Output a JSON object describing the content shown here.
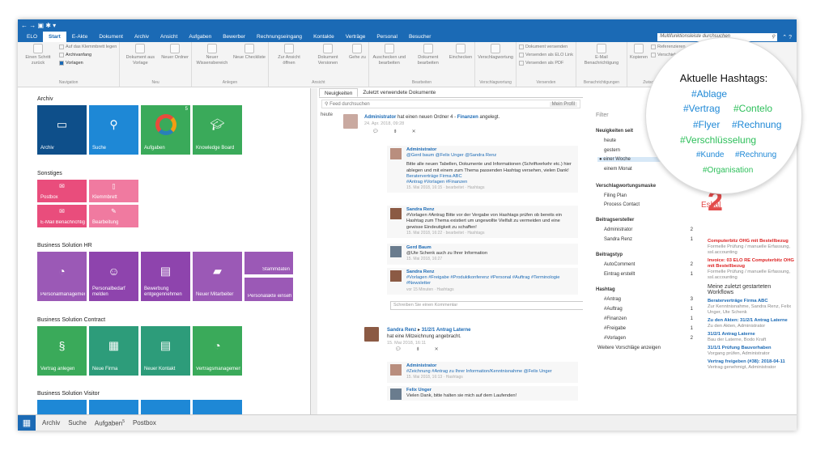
{
  "title": {
    "icons": "← → ▣ ✱ ▾"
  },
  "menu": {
    "items": [
      "ELO",
      "Start",
      "E-Akte",
      "Dokument",
      "Archiv",
      "Ansicht",
      "Aufgaben",
      "Bewerber",
      "Rechnungseingang",
      "Kontakte",
      "Verträge",
      "Personal",
      "Besucher"
    ],
    "active": "Start",
    "search_placeholder": "Multifunktionsleiste durchsuchen",
    "search_icon": "magnifier-icon",
    "help": "⌃ ?"
  },
  "ribbon": {
    "nav": {
      "b1": "Einen Schritt zurück",
      "s1": "Auf das Klemmbrett legen",
      "s2": "Archivanfang",
      "s3": "Vorlagen",
      "label": "Navigation"
    },
    "neu": {
      "b1": "Dokument aus Vorlage",
      "b2": "Neuer Ordner",
      "label": "Neu"
    },
    "anlegen": {
      "b1": "Neuer Wissensbereich",
      "b2": "Neue Checkliste",
      "label": "Anlegen"
    },
    "ansicht": {
      "b1": "Zur Ansicht öffnen",
      "b2": "Dokument Versionen",
      "b3": "Gehe zu",
      "label": "Ansicht"
    },
    "bearbeiten": {
      "b1": "Auschecken und bearbeiten",
      "b2": "Dokument bearbeiten",
      "b3": "Einchecken",
      "label": "Bearbeiten"
    },
    "vers": {
      "b1": "Verschlagwortung",
      "label": "Verschlagwortung"
    },
    "versenden": {
      "s1": "Dokument versenden",
      "s2": "Versenden als ELO Link",
      "s3": "Versenden als PDF",
      "label": "Versenden"
    },
    "benach": {
      "b1": "E-Mail Benachrichtigung",
      "label": "Benachrichtigungen"
    },
    "zw": {
      "b1": "Kopieren",
      "s1": "Referenzieren",
      "s2": "Verschieben",
      "label": "Zwischenablage"
    }
  },
  "left": {
    "archiv": {
      "title": "Archiv",
      "tiles": [
        "Archiv",
        "Suche",
        "Aufgaben",
        "Knowledge Board"
      ],
      "badge": "5"
    },
    "sonstiges": {
      "title": "Sonstiges",
      "tiles": [
        "Postbox",
        "Klemmbrett",
        "E-Mail Benachrichtigung",
        "Bearbeitung"
      ]
    },
    "hr": {
      "title": "Business Solution HR",
      "tiles": [
        "Personalmanagement",
        "Personalbedarf melden",
        "Bewerbung entgegennehmen",
        "Neuer Mitarbeiter",
        "Stammdaten ändern",
        "Personalakte einsehen"
      ]
    },
    "contract": {
      "title": "Business Solution Contract",
      "tiles": [
        "Vertrag anlegen",
        "Neue Firma",
        "Neuer Kontakt",
        "Vertragsmanagement"
      ]
    },
    "visitor": {
      "title": "Business Solution Visitor"
    }
  },
  "center": {
    "tabs": [
      "Neuigkeiten",
      "Zuletzt verwendete Dokumente"
    ],
    "feed_placeholder": "Feed durchsuchen",
    "mein_profil": "Mein Profil",
    "heute": "heute",
    "post1": {
      "author": "Administrator",
      "text": "hat einen neuen Ordner 4 -",
      "folder": "Finanzen",
      "suffix": "angelegt.",
      "date": "24. Apr. 2018, 09:28"
    },
    "c1": {
      "author": "Administrator",
      "mentions": "@Gerd baum @Felix Unger @Sandra Renz",
      "body": "Bitte alle neuen Tabellen, Dokumente und Informationen (Schriftverkehr etc.) hier ablegen und mit einem zum Thema passenden Hashtag versehen, vielen Dank!",
      "link": "Beraterverträge Firma ABC",
      "tags": "#Antrag #Vorlagen #Finanzen",
      "meta": "15. Mai 2018, 16:15 · bearbeitet · Hashtags"
    },
    "c2": {
      "author": "Sandra Renz",
      "body": "#Vorlagen #Antrag Bitte vor der Vergabe von Hashtags prüfen ob bereits ein Hashtag zum Thema existiert um ungewollte Vielfalt zu vermeiden und eine gewisse Eindeutigkeit zu schaffen!",
      "meta": "15. Mai 2018, 16:22 · bearbeitet · Hashtags"
    },
    "c3": {
      "author": "Gerd Baum",
      "body": "@Ute Schenk auch zu Ihrer Information",
      "meta": "15. Mai 2018, 16:27"
    },
    "c4": {
      "author": "Sandra Renz",
      "body": "#Vorlagen #Freigabe #Produktkonferenz #Personal #Auftrag #Terminologie #Newsletter",
      "meta": "vor 15 Minuten · Hashtags"
    },
    "comment_placeholder": "Schreiben Sie einen Kommentar",
    "post2": {
      "author": "Sandra Renz",
      "arrow": "▸",
      "target": "31/2/1 Antrag Laterne",
      "text": "hat eine Mitzeichnung angebracht.",
      "date": "15. Mai 2018, 16:11"
    },
    "c5": {
      "author": "Administrator",
      "body": "#Zeichnung #Antrag zu Ihrer Information/Kenntnisnahme @Felix Unger",
      "meta": "15. Mai 2018, 16:13 · Hashtags"
    },
    "c6": {
      "author": "Felix Unger",
      "body": "Vielen Dank, bitte halten sie mich auf dem Laufenden!"
    }
  },
  "filter": {
    "title": "Filter",
    "neu": {
      "title": "Neuigkeiten seit",
      "items": [
        "heute",
        "gestern",
        "einer Woche",
        "einem Monat"
      ],
      "selected": "einer Woche"
    },
    "maske": {
      "title": "Verschlagwortungsmaske",
      "items": [
        "Filing Plan",
        "Process Contact"
      ]
    },
    "ersteller": {
      "title": "Beitragsersteller",
      "items": [
        [
          "Administrator",
          "2"
        ],
        [
          "Sandra Renz",
          "1"
        ]
      ]
    },
    "typ": {
      "title": "Beitragstyp",
      "items": [
        [
          "AutoComment",
          "2"
        ],
        [
          "Eintrag erstellt",
          "1"
        ]
      ]
    },
    "hashtag": {
      "title": "Hashtag",
      "items": [
        [
          "#Antrag",
          "3"
        ],
        [
          "#Auftrag",
          "1"
        ],
        [
          "#Finanzen",
          "1"
        ],
        [
          "#Freigabe",
          "1"
        ],
        [
          "#Vorlagen",
          "2"
        ]
      ],
      "more": "Weitere Vorschläge anzeigen"
    }
  },
  "right": {
    "r1": "Computerbitz OHG mit Bestellbezug",
    "r1s": "Formelle Prüfung / manuelle Erfassung, ssl.accounting",
    "r2": "Invoice: 03 ELO RE Computerbitz OHG mit Bestellbezug",
    "r2s": "Formelle Prüfung / manuelle Erfassung, ssl.accounting",
    "wf": "Meine zuletzt gestarteten Workflows",
    "w": [
      [
        "Beraterverträge Firma ABC",
        "Zur Kenntnisnahme, Sandra Renz, Felix Unger, Ute Schenk"
      ],
      [
        "Zu den Akten: 31/2/1 Antrag Laterne",
        "Zu den Akten, Administrator"
      ],
      [
        "31/2/1 Antrag Laterne",
        "Bau der Laterne, Bodo Kraft"
      ],
      [
        "31/1/1 Prüfung Bauvorhaben",
        "Vorgang prüfen, Administrator"
      ],
      [
        "Vertrag freigeben (#38): 2018-04-11",
        "Vertrag genehmigt, Administrator"
      ]
    ]
  },
  "eskal": {
    "num": "2",
    "text": "Eskal"
  },
  "magnifier": {
    "title": "Aktuelle Hashtags:",
    "tags": [
      "#Ablage",
      "#Vertrag",
      "#Contelo",
      "#Flyer",
      "#Rechnung",
      "#Verschlüsselung",
      "#Kunde",
      "#Rechnung",
      "#Organisation"
    ]
  },
  "bottom": {
    "items": [
      "Archiv",
      "Suche",
      "Aufgaben",
      "Postbox"
    ],
    "badge": "5"
  },
  "colors": {
    "accent": "#1b6ab5",
    "tile_blue": "#1e88d6",
    "tile_dark": "#0e4f8a",
    "tile_green": "#3aaa5a",
    "tile_pink": "#e94d7c",
    "tile_purple": "#8e44ad",
    "tile_teal": "#2d9c7a"
  }
}
